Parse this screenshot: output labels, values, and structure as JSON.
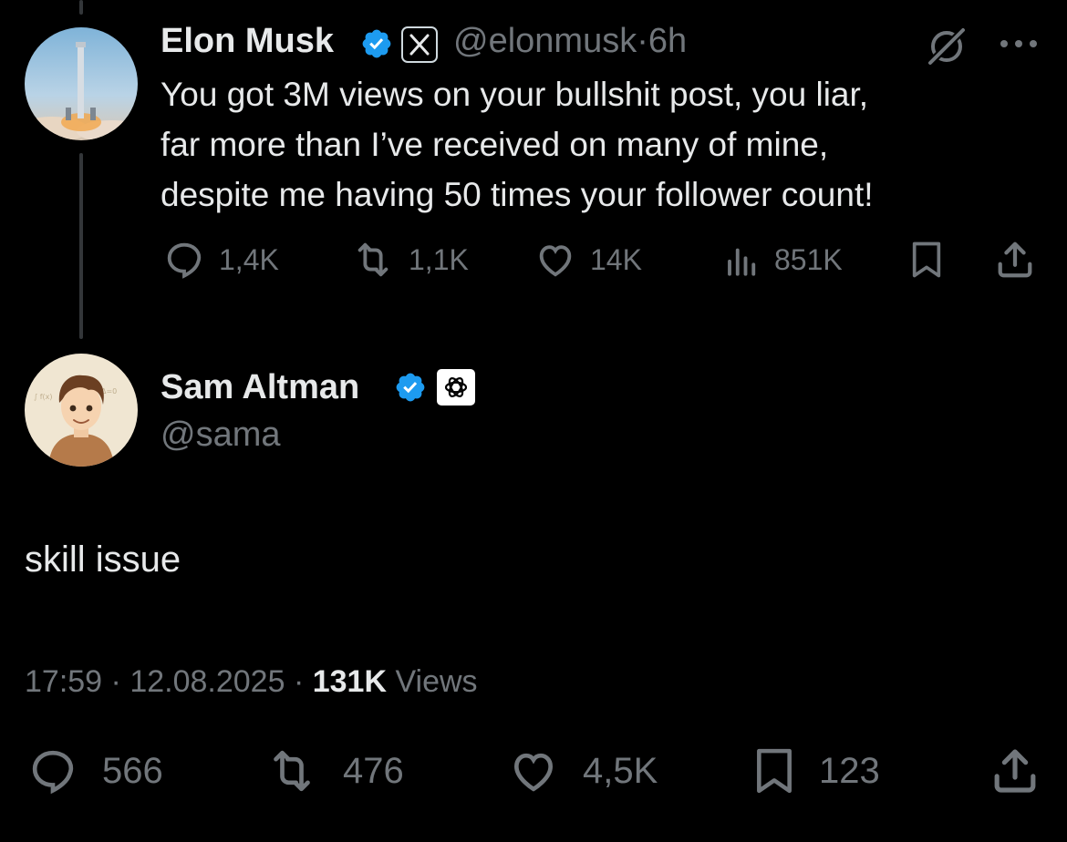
{
  "parent_tweet": {
    "author_name": "Elon Musk",
    "handle": "@elonmusk",
    "separator": "·",
    "time": "6h",
    "text_lines": [
      "You got 3M views on your bullshit post, you liar,",
      "far more than I’ve received on many of mine,",
      "despite me having 50 times your follower count!"
    ],
    "more_icon": "ellipsis-icon",
    "actions": {
      "replies": "1,4K",
      "reposts": "1,1K",
      "likes": "14K",
      "views": "851K"
    }
  },
  "reply_tweet": {
    "author_name": "Sam Altman",
    "handle": "@sama",
    "text": "skill issue",
    "meta": {
      "time": "17:59",
      "sep1": "·",
      "date": "12.08.2025",
      "sep2": "·",
      "views_count": "131K",
      "views_label": "Views"
    },
    "actions": {
      "replies": "566",
      "reposts": "476",
      "likes": "4,5K",
      "bookmarks": "123"
    }
  },
  "colors": {
    "background": "#000000",
    "primary_text": "#e7e9ea",
    "secondary_text": "#71767b",
    "verified_blue": "#1d9bf0",
    "thread_line": "#333639"
  }
}
